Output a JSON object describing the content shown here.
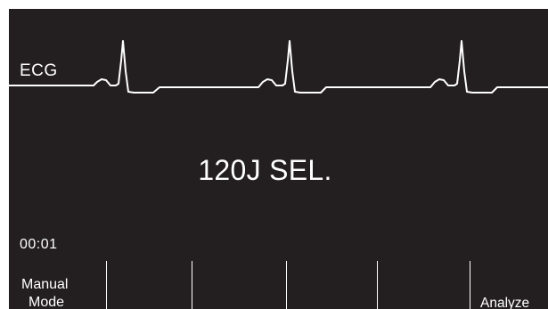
{
  "monitor": {
    "lead_label": "ECG",
    "message": "120J SEL.",
    "elapsed_time": "00:01"
  },
  "softkeys": [
    {
      "line1": "Manual",
      "line2": "Mode"
    },
    {
      "line1": "",
      "line2": ""
    },
    {
      "line1": "",
      "line2": ""
    },
    {
      "line1": "",
      "line2": ""
    },
    {
      "line1": "",
      "line2": ""
    },
    {
      "line1": "Analyze",
      "line2": ""
    }
  ],
  "colors": {
    "screen_background": "#231f20",
    "foreground": "#ffffff"
  }
}
